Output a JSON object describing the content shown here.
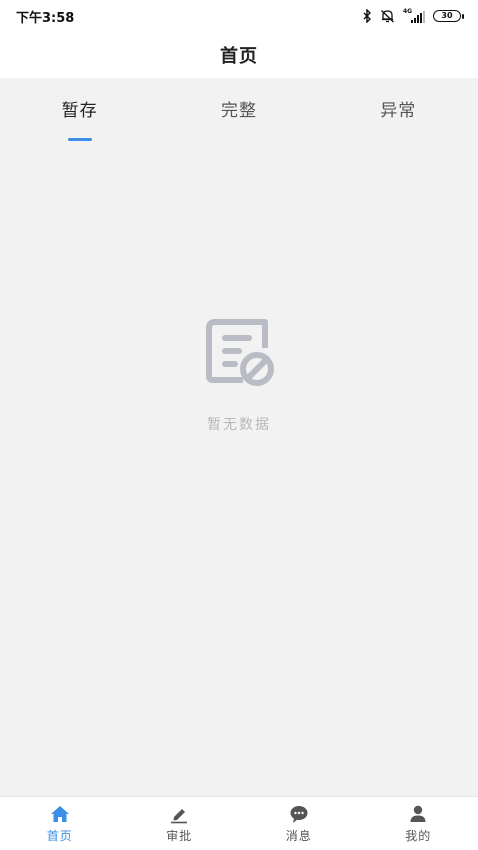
{
  "status_bar": {
    "time": "下午3:58",
    "network": "4G",
    "battery": "30",
    "icons": [
      "bluetooth-icon",
      "alarm-off-icon",
      "signal-icon",
      "battery-icon"
    ]
  },
  "nav": {
    "title": "首页"
  },
  "tabs": [
    {
      "label": "暂存",
      "active": true
    },
    {
      "label": "完整",
      "active": false
    },
    {
      "label": "异常",
      "active": false
    }
  ],
  "empty_state": {
    "icon": "no-document-icon",
    "text": "暂无数据"
  },
  "tabbar": [
    {
      "label": "首页",
      "icon": "home-icon",
      "active": true
    },
    {
      "label": "审批",
      "icon": "pen-icon",
      "active": false
    },
    {
      "label": "消息",
      "icon": "chat-icon",
      "active": false
    },
    {
      "label": "我的",
      "icon": "user-icon",
      "active": false
    }
  ],
  "colors": {
    "accent": "#3a8ee6",
    "background": "#f2f2f3",
    "inactive_icon": "#555555",
    "empty_text": "#b8b8bc"
  }
}
